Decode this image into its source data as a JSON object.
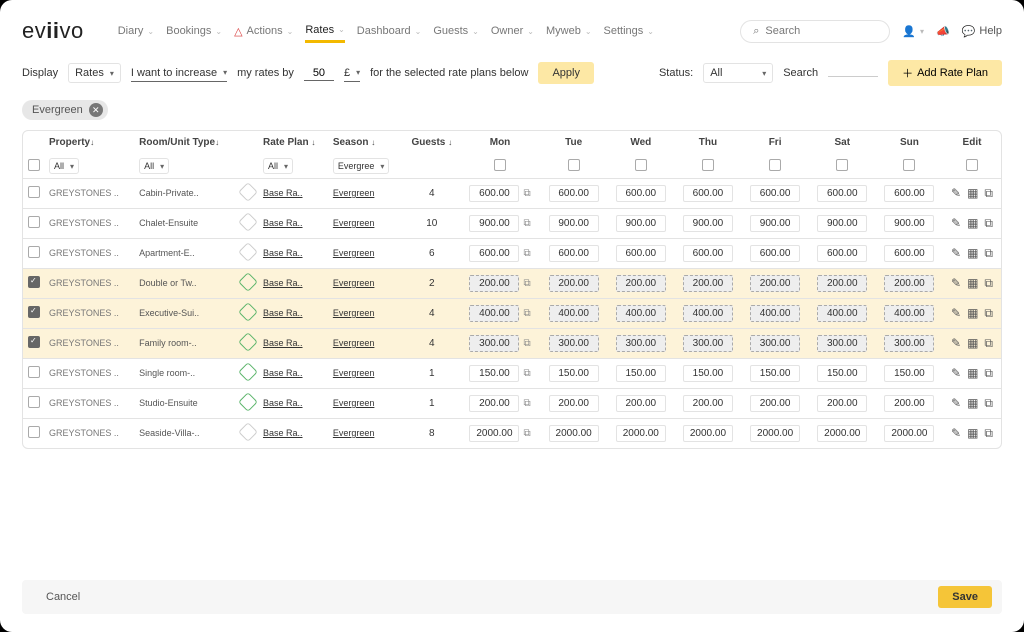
{
  "logo": "eviivo",
  "nav": {
    "items": [
      "Diary",
      "Bookings",
      "Actions",
      "Rates",
      "Dashboard",
      "Guests",
      "Owner",
      "Myweb",
      "Settings"
    ],
    "active": "Rates",
    "alertIndex": 2
  },
  "top": {
    "searchPlaceholder": "Search",
    "help": "Help"
  },
  "controls": {
    "displayLabel": "Display",
    "displayValue": "Rates",
    "modeValue": "I want to increase",
    "byLabel": "my rates by",
    "amount": "50",
    "currency": "£",
    "forLabel": "for the selected rate plans below",
    "applyLabel": "Apply",
    "statusLabel": "Status:",
    "statusValue": "All",
    "searchLabel": "Search",
    "addLabel": "Add Rate Plan"
  },
  "filterChip": "Evergreen",
  "columns": {
    "property": "Property",
    "room": "Room/Unit Type",
    "rateplan": "Rate Plan",
    "season": "Season",
    "guests": "Guests",
    "days": [
      "Mon",
      "Tue",
      "Wed",
      "Thu",
      "Fri",
      "Sat",
      "Sun"
    ],
    "edit": "Edit"
  },
  "filterRow": {
    "property": "All",
    "room": "All",
    "rateplan": "All",
    "season": "Evergree"
  },
  "ratePlanLabel": "Base Ra..",
  "seasonLabel": "Evergreen",
  "propertyLabel": "GREYSTONES ..",
  "rows": [
    {
      "checked": false,
      "room": "Cabin-Private..",
      "promo": false,
      "guests": "4",
      "rate": "600.00",
      "hl": false
    },
    {
      "checked": false,
      "room": "Chalet-Ensuite",
      "promo": false,
      "guests": "10",
      "rate": "900.00",
      "hl": false
    },
    {
      "checked": false,
      "room": "Apartment-E..",
      "promo": false,
      "guests": "6",
      "rate": "600.00",
      "hl": false
    },
    {
      "checked": true,
      "room": "Double or Tw..",
      "promo": true,
      "guests": "2",
      "rate": "200.00",
      "hl": true
    },
    {
      "checked": true,
      "room": "Executive-Sui..",
      "promo": true,
      "guests": "4",
      "rate": "400.00",
      "hl": true
    },
    {
      "checked": true,
      "room": "Family room-..",
      "promo": true,
      "guests": "4",
      "rate": "300.00",
      "hl": true
    },
    {
      "checked": false,
      "room": "Single room-..",
      "promo": true,
      "guests": "1",
      "rate": "150.00",
      "hl": false
    },
    {
      "checked": false,
      "room": "Studio-Ensuite",
      "promo": true,
      "guests": "1",
      "rate": "200.00",
      "hl": false
    },
    {
      "checked": false,
      "room": "Seaside-Villa-..",
      "promo": false,
      "guests": "8",
      "rate": "2000.00",
      "hl": false
    }
  ],
  "footer": {
    "cancel": "Cancel",
    "save": "Save"
  }
}
